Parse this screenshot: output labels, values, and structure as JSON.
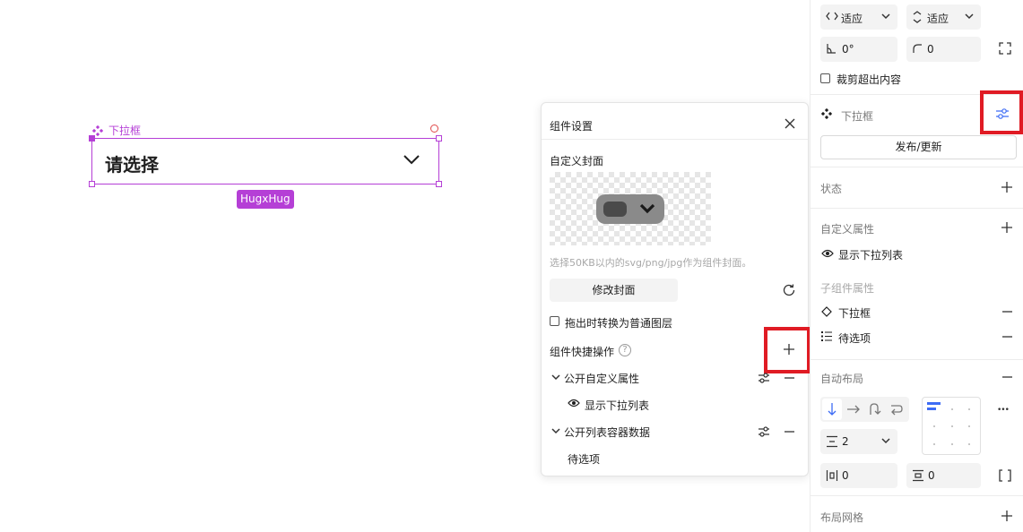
{
  "canvas": {
    "component_tag": "下拉框",
    "placeholder": "请选择",
    "size_label": "HugxHug"
  },
  "popover": {
    "title": "组件设置",
    "cover_label": "自定义封面",
    "cover_hint": "选择50KB以内的svg/png/jpg作为组件封面。",
    "edit_cover_button": "修改封面",
    "convert_checkbox": "拖出时转换为普通图层",
    "quick_actions_label": "组件快捷操作",
    "help_glyph": "?",
    "groups": [
      {
        "label": "公开自定义属性",
        "child": "显示下拉列表"
      },
      {
        "label": "公开列表容器数据",
        "child": "待选项"
      }
    ]
  },
  "panel": {
    "width_mode": "适应",
    "height_mode": "适应",
    "rotation": "0°",
    "radius": "0",
    "clip_content": "裁剪超出内容",
    "component_name": "下拉框",
    "publish_button": "发布/更新",
    "state_label": "状态",
    "custom_props_label": "自定义属性",
    "custom_prop_item": "显示下拉列表",
    "child_props_label": "子组件属性",
    "child_items": [
      "下拉框",
      "待选项"
    ],
    "auto_layout_label": "自动布局",
    "gap": "2",
    "padding_h": "0",
    "padding_v": "0",
    "more_glyph": "•••",
    "layout_grid_label": "布局网格"
  },
  "colors": {
    "component_accent": "#b53fd6",
    "highlight": "#e01b24",
    "active_blue": "#3d6cf5"
  }
}
